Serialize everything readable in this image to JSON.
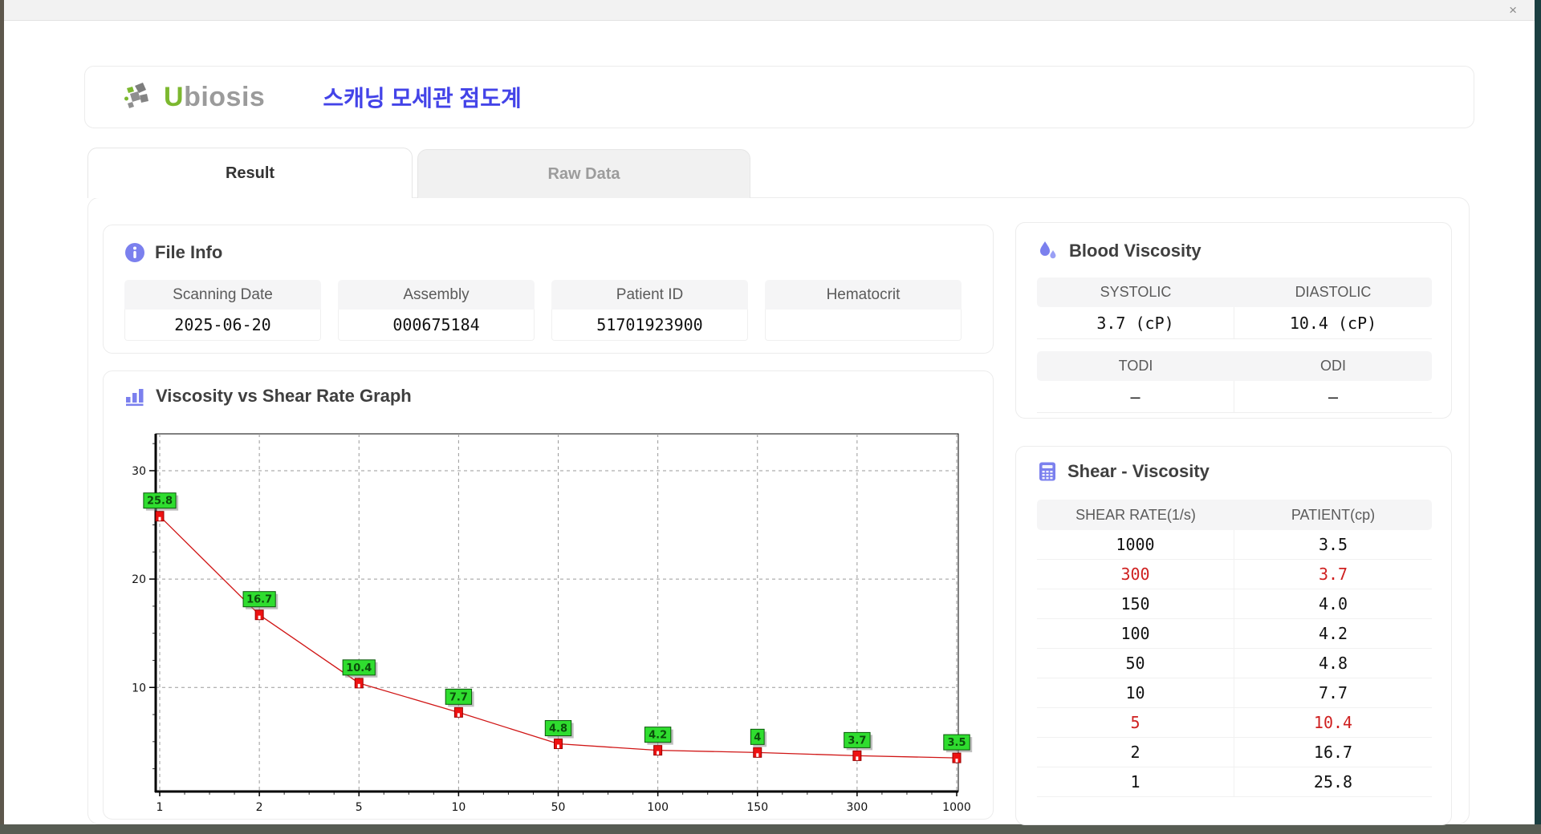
{
  "window": {
    "close_icon": "×"
  },
  "header": {
    "logo_u": "U",
    "logo_rest": "biosis",
    "title": "스캐닝 모세관 점도계"
  },
  "tabs": [
    {
      "label": "Result",
      "active": true
    },
    {
      "label": "Raw Data",
      "active": false
    }
  ],
  "file_info": {
    "title": "File Info",
    "fields": [
      {
        "label": "Scanning Date",
        "value": "2025-06-20"
      },
      {
        "label": "Assembly",
        "value": "000675184"
      },
      {
        "label": "Patient ID",
        "value": "51701923900"
      },
      {
        "label": "Hematocrit",
        "value": ""
      }
    ]
  },
  "blood_viscosity": {
    "title": "Blood Viscosity",
    "groups": [
      {
        "headers": [
          "SYSTOLIC",
          "DIASTOLIC"
        ],
        "values": [
          "3.7 (cP)",
          "10.4 (cP)"
        ]
      },
      {
        "headers": [
          "TODI",
          "ODI"
        ],
        "values": [
          "–",
          "–"
        ]
      }
    ]
  },
  "shear_viscosity": {
    "title": "Shear - Viscosity",
    "columns": [
      "SHEAR RATE(1/s)",
      "PATIENT(cp)"
    ],
    "rows": [
      {
        "shear_rate": "1000",
        "patient": "3.5",
        "highlight": false
      },
      {
        "shear_rate": "300",
        "patient": "3.7",
        "highlight": true
      },
      {
        "shear_rate": "150",
        "patient": "4.0",
        "highlight": false
      },
      {
        "shear_rate": "100",
        "patient": "4.2",
        "highlight": false
      },
      {
        "shear_rate": "50",
        "patient": "4.8",
        "highlight": false
      },
      {
        "shear_rate": "10",
        "patient": "7.7",
        "highlight": false
      },
      {
        "shear_rate": "5",
        "patient": "10.4",
        "highlight": true
      },
      {
        "shear_rate": "2",
        "patient": "16.7",
        "highlight": false
      },
      {
        "shear_rate": "1",
        "patient": "25.8",
        "highlight": false
      }
    ],
    "highlight_color": "#cf2020"
  },
  "graph_section": {
    "title": "Viscosity vs Shear Rate Graph"
  },
  "chart_data": {
    "type": "line",
    "title": "",
    "xlabel": "",
    "ylabel": "",
    "x_categories": [
      "1",
      "2",
      "5",
      "10",
      "50",
      "100",
      "150",
      "300",
      "1000"
    ],
    "values": [
      25.8,
      16.7,
      10.4,
      7.7,
      4.8,
      4.2,
      4,
      3.7,
      3.5
    ],
    "point_labels": [
      "25.8",
      "16.7",
      "10.4",
      "7.7",
      "4.8",
      "4.2",
      "4",
      "3.7",
      "3.5"
    ],
    "y_ticks": [
      10,
      20,
      30
    ],
    "ylim": [
      0.4,
      33.4
    ],
    "grid": "dashed",
    "legend": "none",
    "line_color": "#d01515",
    "marker_color": "#ee1111",
    "marker_stroke": "#990000",
    "label_bg": "#2fdd2f",
    "label_border": "#0b570b",
    "label_text_color": "#0b4d0b",
    "grid_color": "#9a9a9a",
    "axis_color": "#000000"
  },
  "colors": {
    "accent_indigo": "#7b80ee",
    "title_blue": "#4343e8",
    "logo_green": "#7cb82f",
    "logo_gray": "#9b9b9b"
  }
}
